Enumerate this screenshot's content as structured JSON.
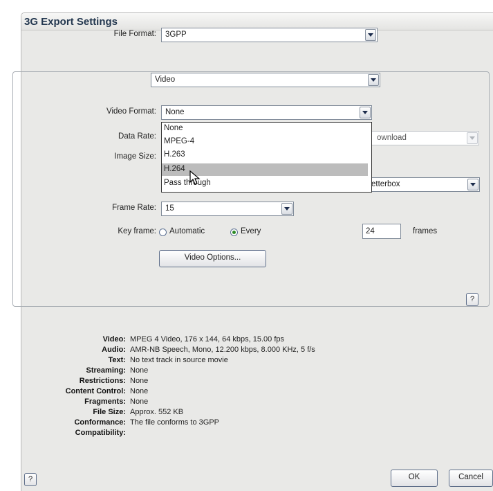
{
  "window": {
    "title": "3G Export Settings"
  },
  "file_format": {
    "label": "File Format:",
    "value": "3GPP"
  },
  "section_selector": {
    "value": "Video"
  },
  "video_format": {
    "label": "Video Format:",
    "value": "None",
    "options": [
      "None",
      "MPEG-4",
      "H.263",
      "H.264",
      "Pass through"
    ],
    "highlighted": "H.264"
  },
  "data_rate": {
    "label": "Data Rate:",
    "partial_value": "ownload"
  },
  "image_size": {
    "label": "Image Size:",
    "partial_value": "etterbox"
  },
  "frame_rate": {
    "label": "Frame Rate:",
    "value": "15"
  },
  "key_frame": {
    "label": "Key frame:",
    "automatic_label": "Automatic",
    "every_label": "Every",
    "selected": "Every",
    "every_value": "24",
    "frames_label": "frames"
  },
  "buttons": {
    "video_options": "Video Options...",
    "help": "?",
    "ok": "OK",
    "cancel": "Cancel"
  },
  "summary": [
    {
      "key": "Video:",
      "value": "MPEG 4 Video, 176 x 144, 64 kbps, 15.00 fps"
    },
    {
      "key": "Audio:",
      "value": "AMR-NB Speech, Mono, 12.200 kbps, 8.000 KHz, 5 f/s"
    },
    {
      "key": "Text:",
      "value": "No text track in source movie"
    },
    {
      "key": "Streaming:",
      "value": "None"
    },
    {
      "key": "Restrictions:",
      "value": "None"
    },
    {
      "key": "Content Control:",
      "value": "None"
    },
    {
      "key": "Fragments:",
      "value": "None"
    },
    {
      "key": "File Size:",
      "value": "Approx. 552 KB"
    },
    {
      "key": "Conformance:",
      "value": "The file conforms to 3GPP"
    },
    {
      "key": "Compatibility:",
      "value": ""
    }
  ]
}
